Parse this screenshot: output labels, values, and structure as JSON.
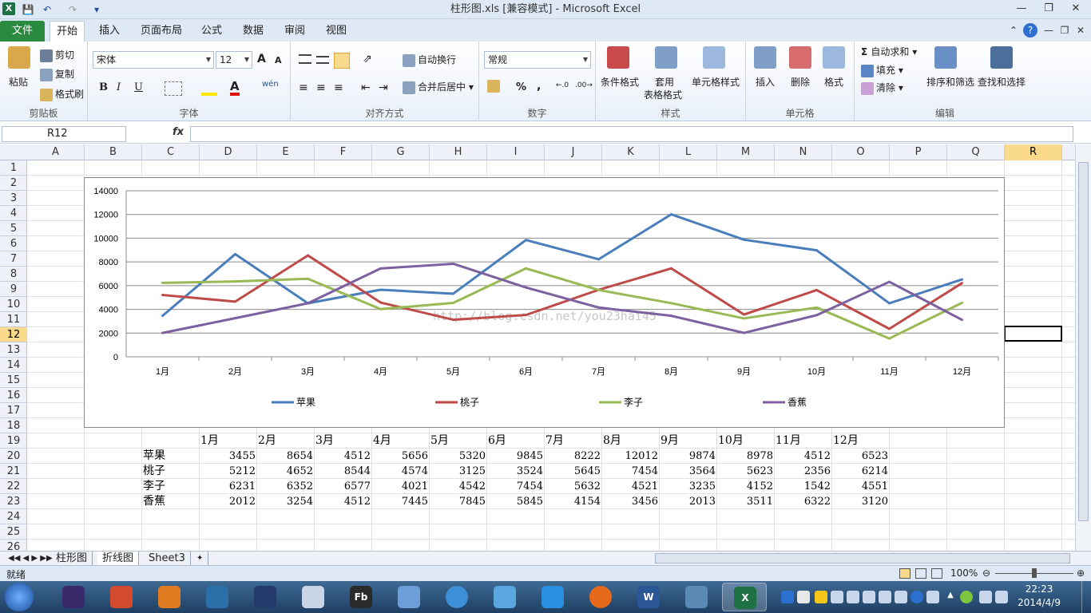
{
  "window": {
    "title": "柱形图.xls  [兼容模式] - Microsoft Excel"
  },
  "tabs": [
    "文件",
    "开始",
    "插入",
    "页面布局",
    "公式",
    "数据",
    "审阅",
    "视图"
  ],
  "ribbon": {
    "clipboard": {
      "paste": "粘贴",
      "cut": "剪切",
      "copy": "复制",
      "format_painter": "格式刷",
      "name": "剪贴板"
    },
    "font": {
      "family": "宋体",
      "size": "12",
      "name": "字体",
      "bold": "B",
      "italic": "I",
      "underline": "U",
      "font_color": "A",
      "grow": "A",
      "shrink": "A",
      "wen": "wén"
    },
    "alignment": {
      "wrap": "自动换行",
      "merge": "合并后居中",
      "name": "对齐方式"
    },
    "number": {
      "format": "常规",
      "percent": "%",
      "comma": ",",
      "name": "数字"
    },
    "styles": {
      "conditional": "条件格式",
      "table1": "套用",
      "table2": "表格格式",
      "cell_styles": "单元格样式",
      "name": "样式"
    },
    "cells": {
      "insert": "插入",
      "delete": "删除",
      "format": "格式",
      "name": "单元格"
    },
    "editing": {
      "autosum": "自动求和",
      "fill": "填充",
      "clear": "清除",
      "sort": "排序和筛选",
      "find": "查找和选择",
      "name": "编辑"
    }
  },
  "formula_bar": {
    "name_box": "R12",
    "fx": "fx",
    "value": ""
  },
  "columns": [
    "A",
    "B",
    "C",
    "D",
    "E",
    "F",
    "G",
    "H",
    "I",
    "J",
    "K",
    "L",
    "M",
    "N",
    "O",
    "P",
    "Q",
    "R"
  ],
  "selected_column": "R",
  "rows": [
    "1",
    "2",
    "3",
    "4",
    "5",
    "6",
    "7",
    "8",
    "9",
    "10",
    "11",
    "12",
    "13",
    "14",
    "15",
    "16",
    "17",
    "18",
    "19",
    "20",
    "21",
    "22",
    "23",
    "24",
    "25",
    "26"
  ],
  "selected_row": "12",
  "table": {
    "months": [
      "1月",
      "2月",
      "3月",
      "4月",
      "5月",
      "6月",
      "7月",
      "8月",
      "9月",
      "10月",
      "11月",
      "12月"
    ],
    "rows": [
      {
        "label": "苹果",
        "values": [
          3455,
          8654,
          4512,
          5656,
          5320,
          9845,
          8222,
          12012,
          9874,
          8978,
          4512,
          6523
        ]
      },
      {
        "label": "桃子",
        "values": [
          5212,
          4652,
          8544,
          4574,
          3125,
          3524,
          5645,
          7454,
          3564,
          5623,
          2356,
          6214
        ]
      },
      {
        "label": "李子",
        "values": [
          6231,
          6352,
          6577,
          4021,
          4542,
          7454,
          5632,
          4521,
          3235,
          4152,
          1542,
          4551
        ]
      },
      {
        "label": "香蕉",
        "values": [
          2012,
          3254,
          4512,
          7445,
          7845,
          5845,
          4154,
          3456,
          2013,
          3511,
          6322,
          3120
        ]
      }
    ]
  },
  "chart_data": {
    "type": "line",
    "title": "",
    "xlabel": "",
    "ylabel": "",
    "categories": [
      "1月",
      "2月",
      "3月",
      "4月",
      "5月",
      "6月",
      "7月",
      "8月",
      "9月",
      "10月",
      "11月",
      "12月"
    ],
    "ylim": [
      0,
      14000
    ],
    "yticks": [
      "0",
      "2000",
      "4000",
      "6000",
      "8000",
      "10000",
      "12000",
      "14000"
    ],
    "grid": true,
    "legend": "bottom",
    "series": [
      {
        "name": "苹果",
        "color": "#4a7ebb",
        "values": [
          3455,
          8654,
          4512,
          5656,
          5320,
          9845,
          8222,
          12012,
          9874,
          8978,
          4512,
          6523
        ]
      },
      {
        "name": "桃子",
        "color": "#be4b48",
        "values": [
          5212,
          4652,
          8544,
          4574,
          3125,
          3524,
          5645,
          7454,
          3564,
          5623,
          2356,
          6214
        ]
      },
      {
        "name": "李子",
        "color": "#98b954",
        "values": [
          6231,
          6352,
          6577,
          4021,
          4542,
          7454,
          5632,
          4521,
          3235,
          4152,
          1542,
          4551
        ]
      },
      {
        "name": "香蕉",
        "color": "#7d60a0",
        "values": [
          2012,
          3254,
          4512,
          7445,
          7845,
          5845,
          4154,
          3456,
          2013,
          3511,
          6322,
          3120
        ]
      }
    ],
    "watermark": "http://blog.csdn.net/you23hai45"
  },
  "sheets": [
    "柱形图",
    "折线图",
    "Sheet3"
  ],
  "active_sheet": "折线图",
  "status": {
    "ready": "就绪",
    "zoom": "100%"
  },
  "clock": {
    "time": "22:23",
    "date": "2014/4/9"
  }
}
